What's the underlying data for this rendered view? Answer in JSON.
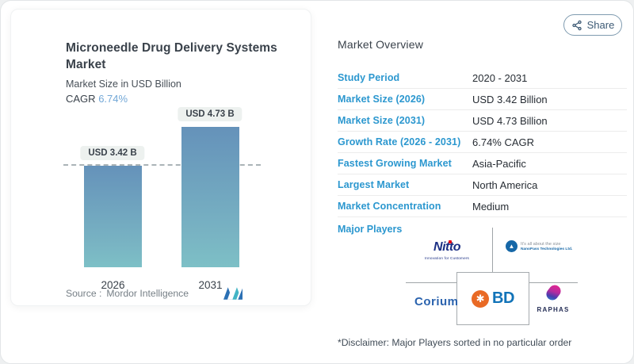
{
  "chart_panel": {
    "title": "Microneedle Drug Delivery Systems Market",
    "subtitle": "Market Size in USD Billion",
    "cagr_label": "CAGR",
    "cagr_value": "6.74%",
    "source_label": "Source :",
    "source_value": "Mordor Intelligence"
  },
  "chart_data": {
    "type": "bar",
    "categories": [
      "2026",
      "2031"
    ],
    "values": [
      3.42,
      4.73
    ],
    "bar_labels": [
      "USD 3.42 B",
      "USD 4.73 B"
    ],
    "title": "Microneedle Drug Delivery Systems Market",
    "ylabel": "Market Size in USD Billion",
    "ylim": [
      0,
      5.35
    ],
    "grid": false,
    "reference_line": 3.42,
    "legend_position": "none"
  },
  "share": {
    "label": "Share"
  },
  "overview": {
    "heading": "Market Overview",
    "rows": [
      {
        "label": "Study Period",
        "value": "2020 - 2031"
      },
      {
        "label": "Market Size (2026)",
        "value": "USD 3.42 Billion"
      },
      {
        "label": "Market Size (2031)",
        "value": "USD 4.73 Billion"
      },
      {
        "label": "Growth Rate (2026 - 2031)",
        "value": "6.74% CAGR"
      },
      {
        "label": "Fastest Growing Market",
        "value": "Asia-Pacific"
      },
      {
        "label": "Largest Market",
        "value": "North America"
      },
      {
        "label": "Market Concentration",
        "value": "Medium"
      }
    ]
  },
  "players": {
    "label": "Major Players",
    "disclaimer": "*Disclaimer: Major Players sorted in no particular order",
    "items": [
      {
        "name": "Nitto",
        "tagline": "Innovation for Customers"
      },
      {
        "name": "NanoPass Technologies Ltd.",
        "tagline": "It's all about the size"
      },
      {
        "name": "Corium"
      },
      {
        "name": "BD"
      },
      {
        "name": "RAPHAS"
      }
    ]
  },
  "colors": {
    "label_blue": "#2b97cf",
    "cagr_blue": "#73a8d7",
    "bar_gradient_top": "#6592ba",
    "bar_gradient_bottom": "#7dc0c6",
    "nitto_navy": "#1b2f84",
    "nitto_red": "#e60012",
    "nanopass_blue": "#1667a7",
    "corium_blue": "#2b63ae",
    "bd_orange": "#e96a25",
    "bd_blue": "#1173b8",
    "raphas_pink": "#ec268f",
    "raphas_purple": "#4a3cae",
    "mordor_blue": "#2b70b4",
    "mordor_teal": "#43b5c5"
  }
}
